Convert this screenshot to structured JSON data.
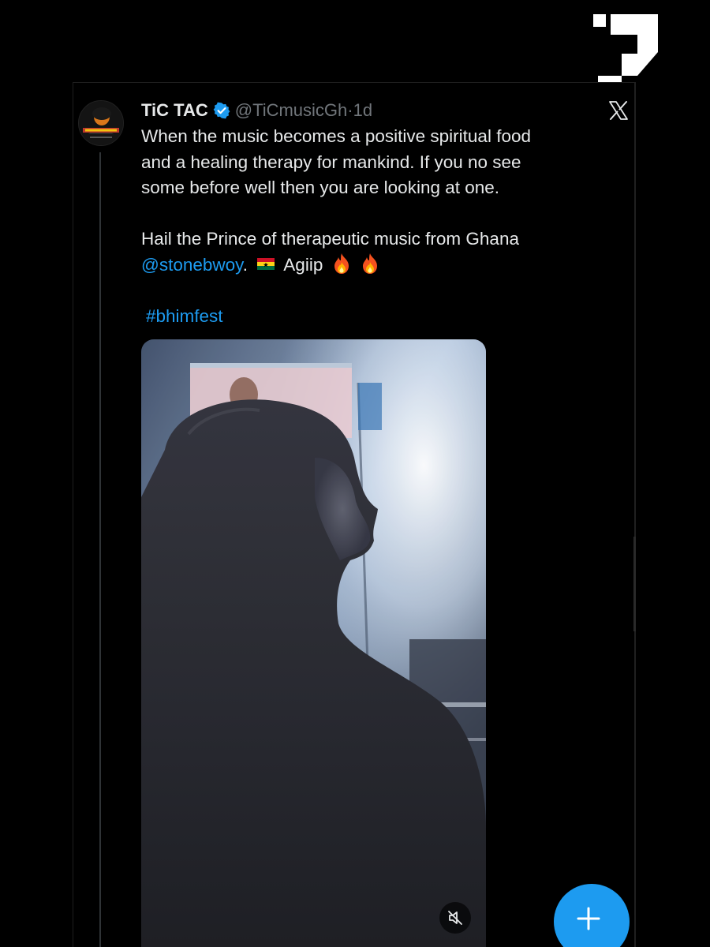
{
  "tweet": {
    "display_name": "TiC TAC",
    "handle": "@TiCmusicGh",
    "separator": "·",
    "time": "1d",
    "verified_icon": "verified-badge-icon",
    "body": {
      "line1": "When the music becomes a positive spiritual  food",
      "line2": "and  a healing therapy for mankind. If you no see",
      "line3": "some before well then you are looking at one.",
      "line4": "Hail the Prince of  therapeutic  music from  Ghana",
      "mention": "@stonebwoy",
      "after_mention": ".",
      "after_flag": "Agiip",
      "hashtag": "#bhimfest"
    },
    "flag_icon": "ghana-flag-icon",
    "emoji_icons": [
      "fire-icon",
      "fire-icon"
    ]
  },
  "icons": {
    "platform_logo": "x-logo-icon",
    "media_mute": "speaker-muted-icon",
    "compose": "plus-icon",
    "brand_mark": "question-mark-logo"
  },
  "colors": {
    "background": "#000000",
    "text": "#e7e9ea",
    "secondary_text": "#71767b",
    "link": "#1d9bf0",
    "fab": "#1d9bf0"
  }
}
